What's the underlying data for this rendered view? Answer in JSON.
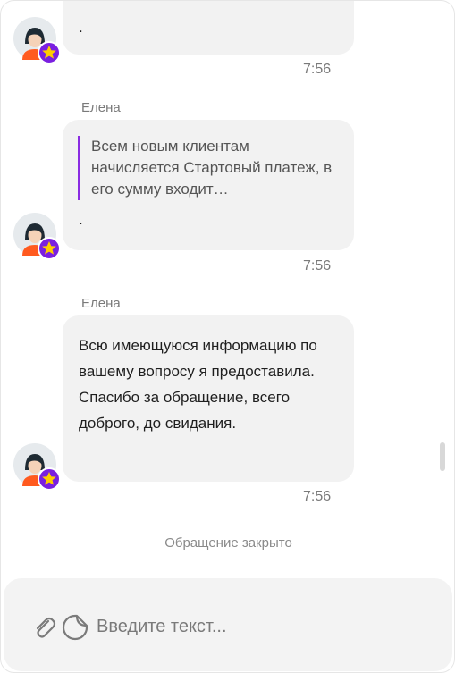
{
  "messages": [
    {
      "sender": "",
      "text": ".",
      "time": "7:56"
    },
    {
      "sender": "Елена",
      "quote": "Всем новым клиентам начисляется Стартовый платеж, в его сумму входит…",
      "text": ".",
      "time": "7:56"
    },
    {
      "sender": "Елена",
      "text": "Всю имеющуюся информацию по вашему вопросу я предоставила. Спасибо за обращение, всего доброго, до свидания.",
      "time": "7:56"
    }
  ],
  "status": {
    "closed_note": "Обращение закрыто"
  },
  "composer": {
    "placeholder": "Введите текст..."
  },
  "icons": {
    "attach": "paperclip-icon",
    "sticker": "sticker-icon",
    "avatar_badge": "star-icon"
  },
  "colors": {
    "accent": "#8a2be2",
    "badge": "#7a1fe0",
    "star": "#ffcc00",
    "bubble": "#f2f2f2"
  }
}
